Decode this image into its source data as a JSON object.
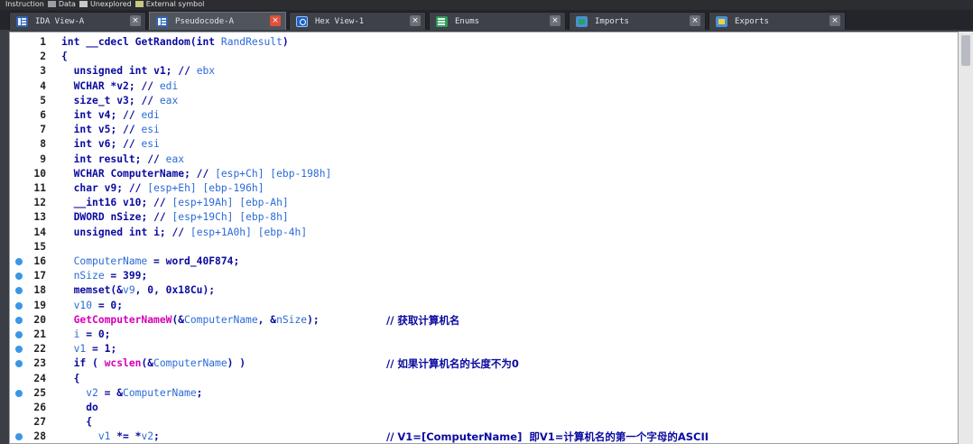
{
  "legend": {
    "items": [
      {
        "label": "Instruction",
        "color": "#9aa0a6"
      },
      {
        "label": "Data",
        "color": "#c8c8c8"
      },
      {
        "label": "Unexplored",
        "color": "#c8c880"
      },
      {
        "label": "External symbol",
        "color": "#e87ad8"
      }
    ]
  },
  "tabs": [
    {
      "label": "IDA View-A",
      "icon": "ida-view-icon",
      "active": false
    },
    {
      "label": "Pseudocode-A",
      "icon": "pseudocode-icon",
      "active": true
    },
    {
      "label": "Hex View-1",
      "icon": "hex-view-icon",
      "active": false
    },
    {
      "label": "Enums",
      "icon": "enums-icon",
      "active": false
    },
    {
      "label": "Imports",
      "icon": "imports-icon",
      "active": false
    },
    {
      "label": "Exports",
      "icon": "exports-icon",
      "active": false
    }
  ],
  "close_glyph": "×",
  "code_lines": [
    {
      "num": "1",
      "dot": false,
      "text": "int __cdecl GetRandom(int RandResult)",
      "comment": ""
    },
    {
      "num": "2",
      "dot": false,
      "text": "{",
      "comment": ""
    },
    {
      "num": "3",
      "dot": false,
      "text": "  unsigned int v1; // ebx",
      "comment": ""
    },
    {
      "num": "4",
      "dot": false,
      "text": "  WCHAR *v2; // edi",
      "comment": ""
    },
    {
      "num": "5",
      "dot": false,
      "text": "  size_t v3; // eax",
      "comment": ""
    },
    {
      "num": "6",
      "dot": false,
      "text": "  int v4; // edi",
      "comment": ""
    },
    {
      "num": "7",
      "dot": false,
      "text": "  int v5; // esi",
      "comment": ""
    },
    {
      "num": "8",
      "dot": false,
      "text": "  int v6; // esi",
      "comment": ""
    },
    {
      "num": "9",
      "dot": false,
      "text": "  int result; // eax",
      "comment": ""
    },
    {
      "num": "10",
      "dot": false,
      "text": "  WCHAR ComputerName; // [esp+Ch] [ebp-198h]",
      "comment": ""
    },
    {
      "num": "11",
      "dot": false,
      "text": "  char v9; // [esp+Eh] [ebp-196h]",
      "comment": ""
    },
    {
      "num": "12",
      "dot": false,
      "text": "  __int16 v10; // [esp+19Ah] [ebp-Ah]",
      "comment": ""
    },
    {
      "num": "13",
      "dot": false,
      "text": "  DWORD nSize; // [esp+19Ch] [ebp-8h]",
      "comment": ""
    },
    {
      "num": "14",
      "dot": false,
      "text": "  unsigned int i; // [esp+1A0h] [ebp-4h]",
      "comment": ""
    },
    {
      "num": "15",
      "dot": false,
      "text": "",
      "comment": ""
    },
    {
      "num": "16",
      "dot": true,
      "text": "  ComputerName = word_40F874;",
      "comment": ""
    },
    {
      "num": "17",
      "dot": true,
      "text": "  nSize = 399;",
      "comment": ""
    },
    {
      "num": "18",
      "dot": true,
      "text": "  memset(&v9, 0, 0x18Cu);",
      "comment": ""
    },
    {
      "num": "19",
      "dot": true,
      "text": "  v10 = 0;",
      "comment": ""
    },
    {
      "num": "20",
      "dot": true,
      "text": "  GetComputerNameW(&ComputerName, &nSize);",
      "comment": "// 获取计算机名"
    },
    {
      "num": "21",
      "dot": true,
      "text": "  i = 0;",
      "comment": ""
    },
    {
      "num": "22",
      "dot": true,
      "text": "  v1 = 1;",
      "comment": ""
    },
    {
      "num": "23",
      "dot": true,
      "text": "  if ( wcslen(&ComputerName) )",
      "comment": "// 如果计算机名的长度不为0"
    },
    {
      "num": "24",
      "dot": false,
      "text": "  {",
      "comment": ""
    },
    {
      "num": "25",
      "dot": true,
      "text": "    v2 = &ComputerName;",
      "comment": ""
    },
    {
      "num": "26",
      "dot": false,
      "text": "    do",
      "comment": ""
    },
    {
      "num": "27",
      "dot": false,
      "text": "    {",
      "comment": ""
    },
    {
      "num": "28",
      "dot": true,
      "text": "      v1 *= *v2;",
      "comment": "// V1=[ComputerName]  即V1=计算机名的第一个字母的ASCII"
    }
  ]
}
